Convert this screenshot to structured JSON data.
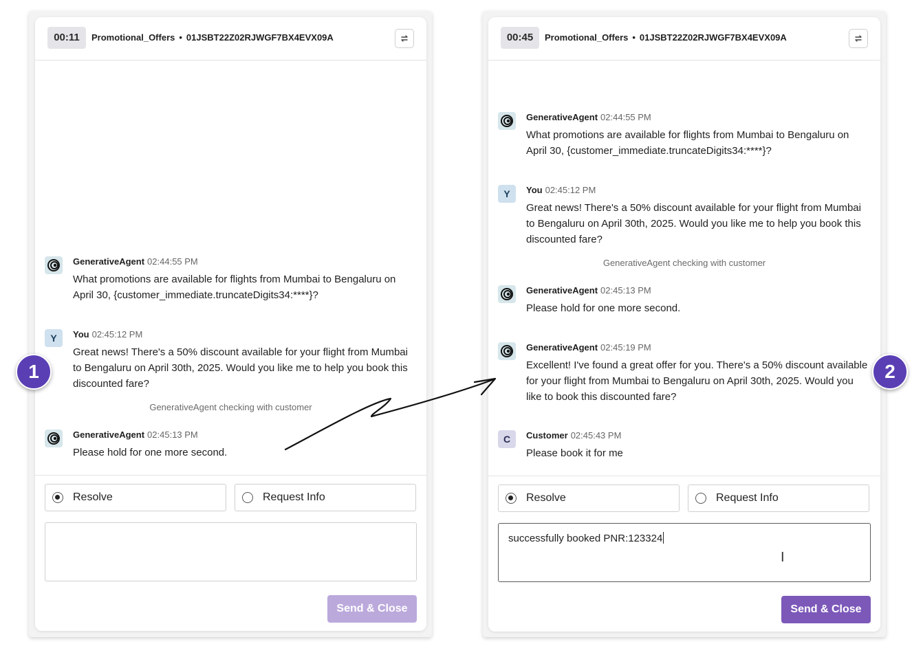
{
  "colors": {
    "accent": "#7c58b9",
    "accent_disabled": "#bba9dc",
    "step_badge": "#5a3fb4"
  },
  "steps": [
    {
      "label": "1"
    },
    {
      "label": "2"
    }
  ],
  "panel1": {
    "header": {
      "timer": "00:11",
      "queue": "Promotional_Offers",
      "separator": "•",
      "conversation_id": "01JSBT22Z02RJWGF7BX4EVX09A",
      "transfer_icon": "transfer-arrows-icon"
    },
    "messages": [
      {
        "avatar": "agent-icon",
        "sender": "GenerativeAgent",
        "time": "02:44:55 PM",
        "text": "What promotions are available for flights from Mumbai to Bengaluru on April 30, {customer_immediate.truncateDigits34:****}?"
      },
      {
        "avatar": "Y",
        "sender": "You",
        "time": "02:45:12 PM",
        "text": "Great news! There's a 50% discount available for your flight from Mumbai to Bengaluru on April 30th, 2025. Would you like me to help you book this discounted fare?"
      },
      {
        "avatar": "agent-icon",
        "sender": "GenerativeAgent",
        "time": "02:45:13 PM",
        "text": "Please hold for one more second."
      }
    ],
    "system_note": "GenerativeAgent checking with customer",
    "reply": {
      "options": [
        {
          "label": "Resolve",
          "checked": true
        },
        {
          "label": "Request Info",
          "checked": false
        }
      ],
      "note_value": "",
      "send_label": "Send & Close",
      "send_enabled": false
    }
  },
  "panel2": {
    "header": {
      "timer": "00:45",
      "queue": "Promotional_Offers",
      "separator": "•",
      "conversation_id": "01JSBT22Z02RJWGF7BX4EVX09A",
      "transfer_icon": "transfer-arrows-icon"
    },
    "messages": [
      {
        "avatar": "agent-icon",
        "sender": "GenerativeAgent",
        "time": "02:44:55 PM",
        "text": "What promotions are available for flights from Mumbai to Bengaluru on April 30, {customer_immediate.truncateDigits34:****}?"
      },
      {
        "avatar": "Y",
        "sender": "You",
        "time": "02:45:12 PM",
        "text": "Great news! There's a 50% discount available for your flight from Mumbai to Bengaluru on April 30th, 2025. Would you like me to help you book this discounted fare?"
      },
      {
        "avatar": "agent-icon",
        "sender": "GenerativeAgent",
        "time": "02:45:13 PM",
        "text": "Please hold for one more second."
      },
      {
        "avatar": "agent-icon",
        "sender": "GenerativeAgent",
        "time": "02:45:19 PM",
        "text": "Excellent! I've found a great offer for you. There's a 50% discount available for your flight from Mumbai to Bengaluru on April 30th, 2025. Would you like to book this discounted fare?"
      },
      {
        "avatar": "C",
        "sender": "Customer",
        "time": "02:45:43 PM",
        "text": "Please book it for me"
      }
    ],
    "system_note": "GenerativeAgent checking with customer",
    "reply": {
      "options": [
        {
          "label": "Resolve",
          "checked": true
        },
        {
          "label": "Request Info",
          "checked": false
        }
      ],
      "note_value": "successfully booked PNR:123324",
      "send_label": "Send & Close",
      "send_enabled": true
    }
  }
}
